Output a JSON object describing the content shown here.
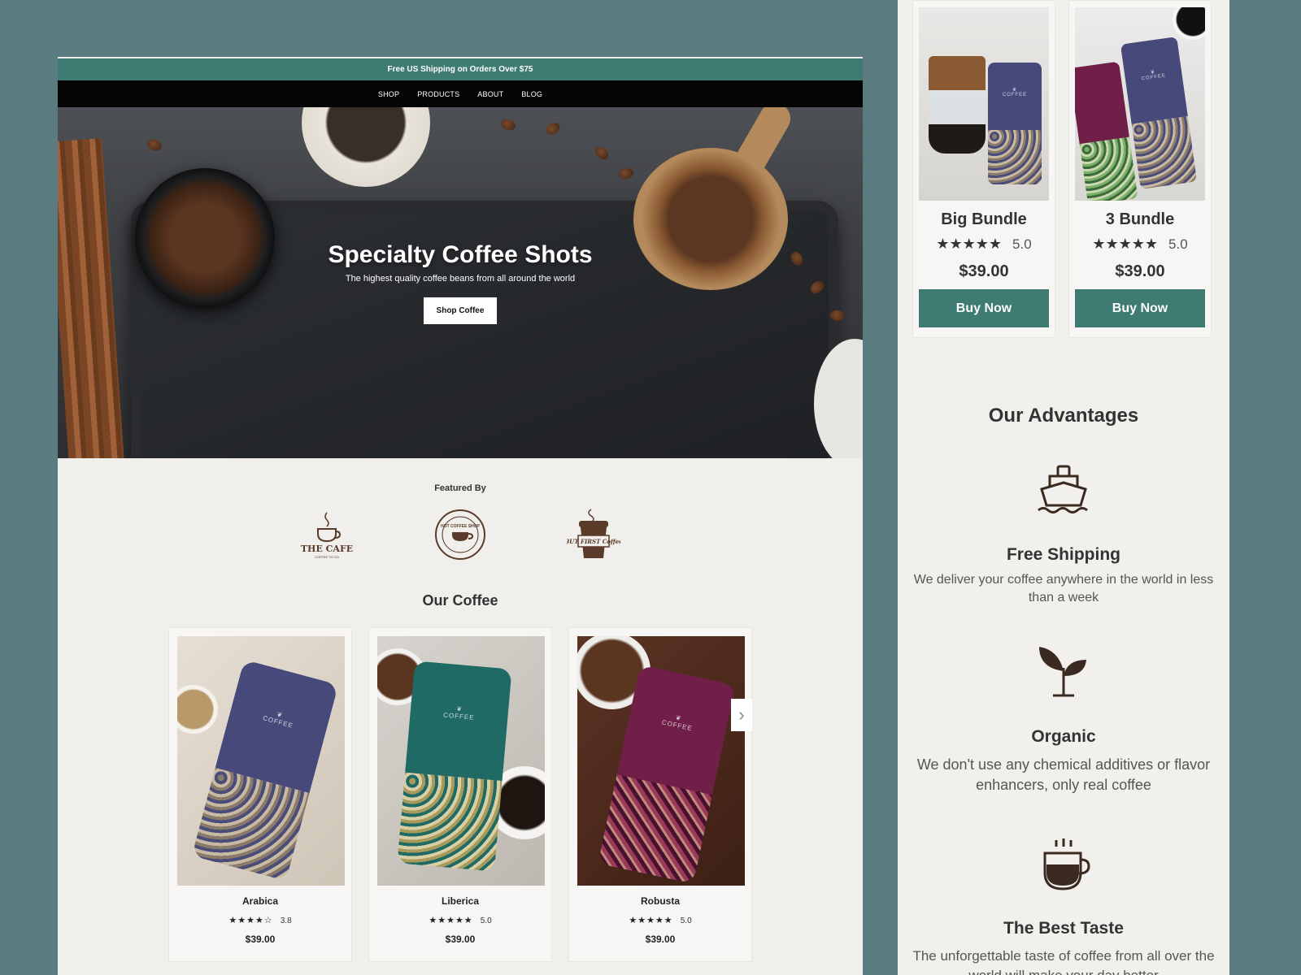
{
  "left": {
    "announcement": "Free US Shipping on Orders Over $75",
    "nav": [
      "SHOP",
      "PRODUCTS",
      "ABOUT",
      "BLOG"
    ],
    "hero": {
      "title": "Specialty Coffee Shots",
      "subtitle": "The highest quality coffee beans from all around the world",
      "button": "Shop Coffee"
    },
    "featured_label": "Featured By",
    "logos": [
      {
        "text": "THE CAFE",
        "sub": "COFFEE TO GO",
        "icon": "cafe-cup-icon"
      },
      {
        "text": "HOT COFFEE SHOP",
        "icon": "hot-coffee-badge-icon"
      },
      {
        "text": "BUT FIRST Coffee",
        "icon": "coffee-takeaway-icon"
      }
    ],
    "section_title": "Our Coffee",
    "products": [
      {
        "name": "Arabica",
        "stars": "★★★★☆",
        "rating": "3.8",
        "price": "$39.00",
        "color": "#46497a",
        "pattern": "#8a7a6a"
      },
      {
        "name": "Liberica",
        "stars": "★★★★★",
        "rating": "5.0",
        "price": "$39.00",
        "color": "#1f6a64",
        "pattern": "#a89a5a"
      },
      {
        "name": "Robusta",
        "stars": "★★★★★",
        "rating": "5.0",
        "price": "$39.00",
        "color": "#6f1f48",
        "pattern": "#9a3a5a"
      }
    ],
    "carousel_next_icon": "chevron-right-icon"
  },
  "right": {
    "bundles": [
      {
        "name": "Big Bundle",
        "stars": "★★★★★",
        "rating": "5.0",
        "price": "$39.00",
        "button": "Buy Now"
      },
      {
        "name": "3 Bundle",
        "stars": "★★★★★",
        "rating": "5.0",
        "price": "$39.00",
        "button": "Buy Now"
      }
    ],
    "advantages_title": "Our Advantages",
    "advantages": [
      {
        "title": "Free Shipping",
        "desc": "We deliver your coffee anywhere in the world in less than a week",
        "icon": "ship-icon"
      },
      {
        "title": "Organic",
        "desc": "We don't use any chemical additives or flavor enhancers, only real coffee",
        "icon": "sprout-icon"
      },
      {
        "title": "The Best Taste",
        "desc": "The unforgettable taste of coffee from all over the world will make your day better",
        "icon": "coffee-cup-icon"
      }
    ]
  },
  "colors": {
    "background": "#5a7b80",
    "accent": "#3e7b72",
    "nav": "#050505",
    "page": "#f0efeb",
    "brown": "#5a3b2a"
  }
}
